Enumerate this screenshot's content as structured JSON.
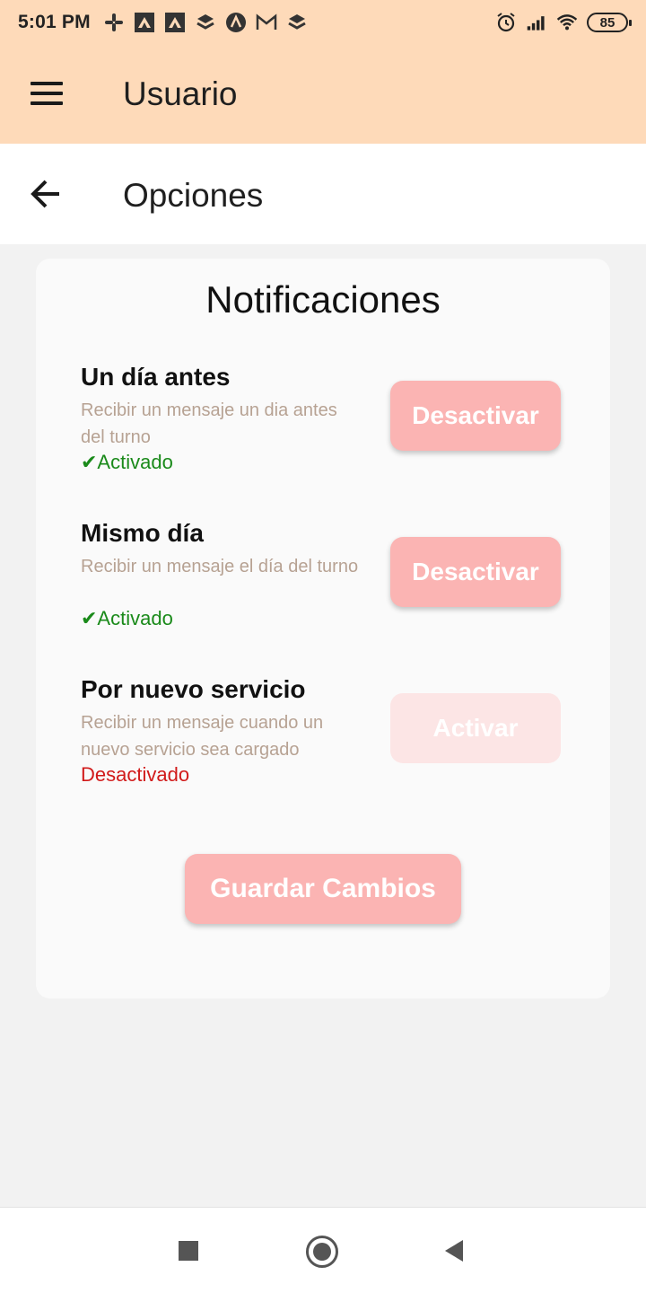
{
  "status_bar": {
    "time": "5:01 PM",
    "notification_icons": [
      "slack-icon",
      "app-icon",
      "app-icon",
      "layers-icon",
      "a-icon",
      "gmail-icon",
      "layers-icon"
    ],
    "alarm_icon": "alarm-icon",
    "signal_icon": "signal-icon",
    "wifi_icon": "wifi-icon",
    "battery": "85"
  },
  "app_bar": {
    "menu_icon": "hamburger-menu-icon",
    "title": "Usuario"
  },
  "sub_bar": {
    "back_icon": "back-arrow-icon",
    "title": "Opciones"
  },
  "card": {
    "title": "Notificaciones",
    "options": [
      {
        "title": "Un día antes",
        "description": "Recibir un mensaje un dia antes del turno",
        "status": "✔Activado",
        "button": "Desactivar"
      },
      {
        "title": "Mismo día",
        "description": "Recibir un mensaje el día del turno",
        "status": "✔Activado",
        "button": "Desactivar"
      },
      {
        "title": "Por nuevo servicio",
        "description": "Recibir un mensaje cuando un nuevo servicio sea cargado",
        "status": "Desactivado",
        "button": "Activar"
      }
    ],
    "save_button": "Guardar Cambios"
  },
  "colors": {
    "header_bg": "#fedab9",
    "button_active": "#fbb4b3",
    "button_muted": "#fce5e5",
    "status_on": "#1a8a1a",
    "status_off": "#d11a1a",
    "description": "#b7a293"
  },
  "nav_bar": {
    "recents_icon": "square-recents-icon",
    "home_icon": "circle-home-icon",
    "back_icon": "triangle-back-icon"
  }
}
